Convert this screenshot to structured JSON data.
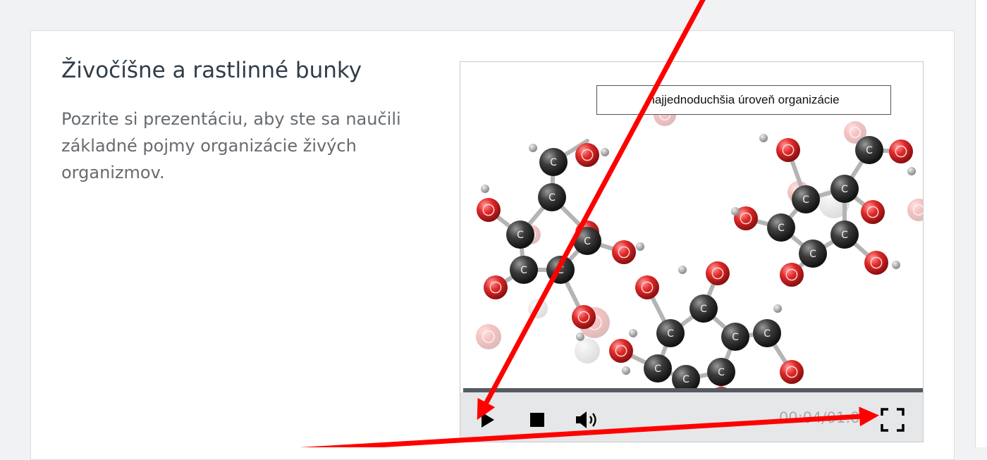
{
  "lesson": {
    "title": "Živočíšne a rastlinné bunky",
    "description": "Pozrite si prezentáciu, aby ste sa naučili základné pojmy organizácie živých organizmov."
  },
  "player": {
    "caption": "najjednoduchšia úroveň organizácie",
    "time": "00:04/01:05",
    "progress_percent": 0,
    "atom_labels": {
      "carbon": "C"
    }
  },
  "icons": {
    "play": "play-icon",
    "stop": "stop-icon",
    "volume": "volume-icon",
    "fullscreen": "fullscreen-icon"
  },
  "colors": {
    "page_bg": "#f1f2f3",
    "title": "#2f3d4a",
    "description": "#666b70",
    "controls_bg": "#e6e7e8",
    "progress_track": "#555b60",
    "time_text": "#a7aaad",
    "annotation_arrow": "#ff0000",
    "oxygen_atom": "#d42a2a",
    "carbon_atom": "#3a3a3a",
    "hydrogen_atom": "#9a9a9a"
  }
}
